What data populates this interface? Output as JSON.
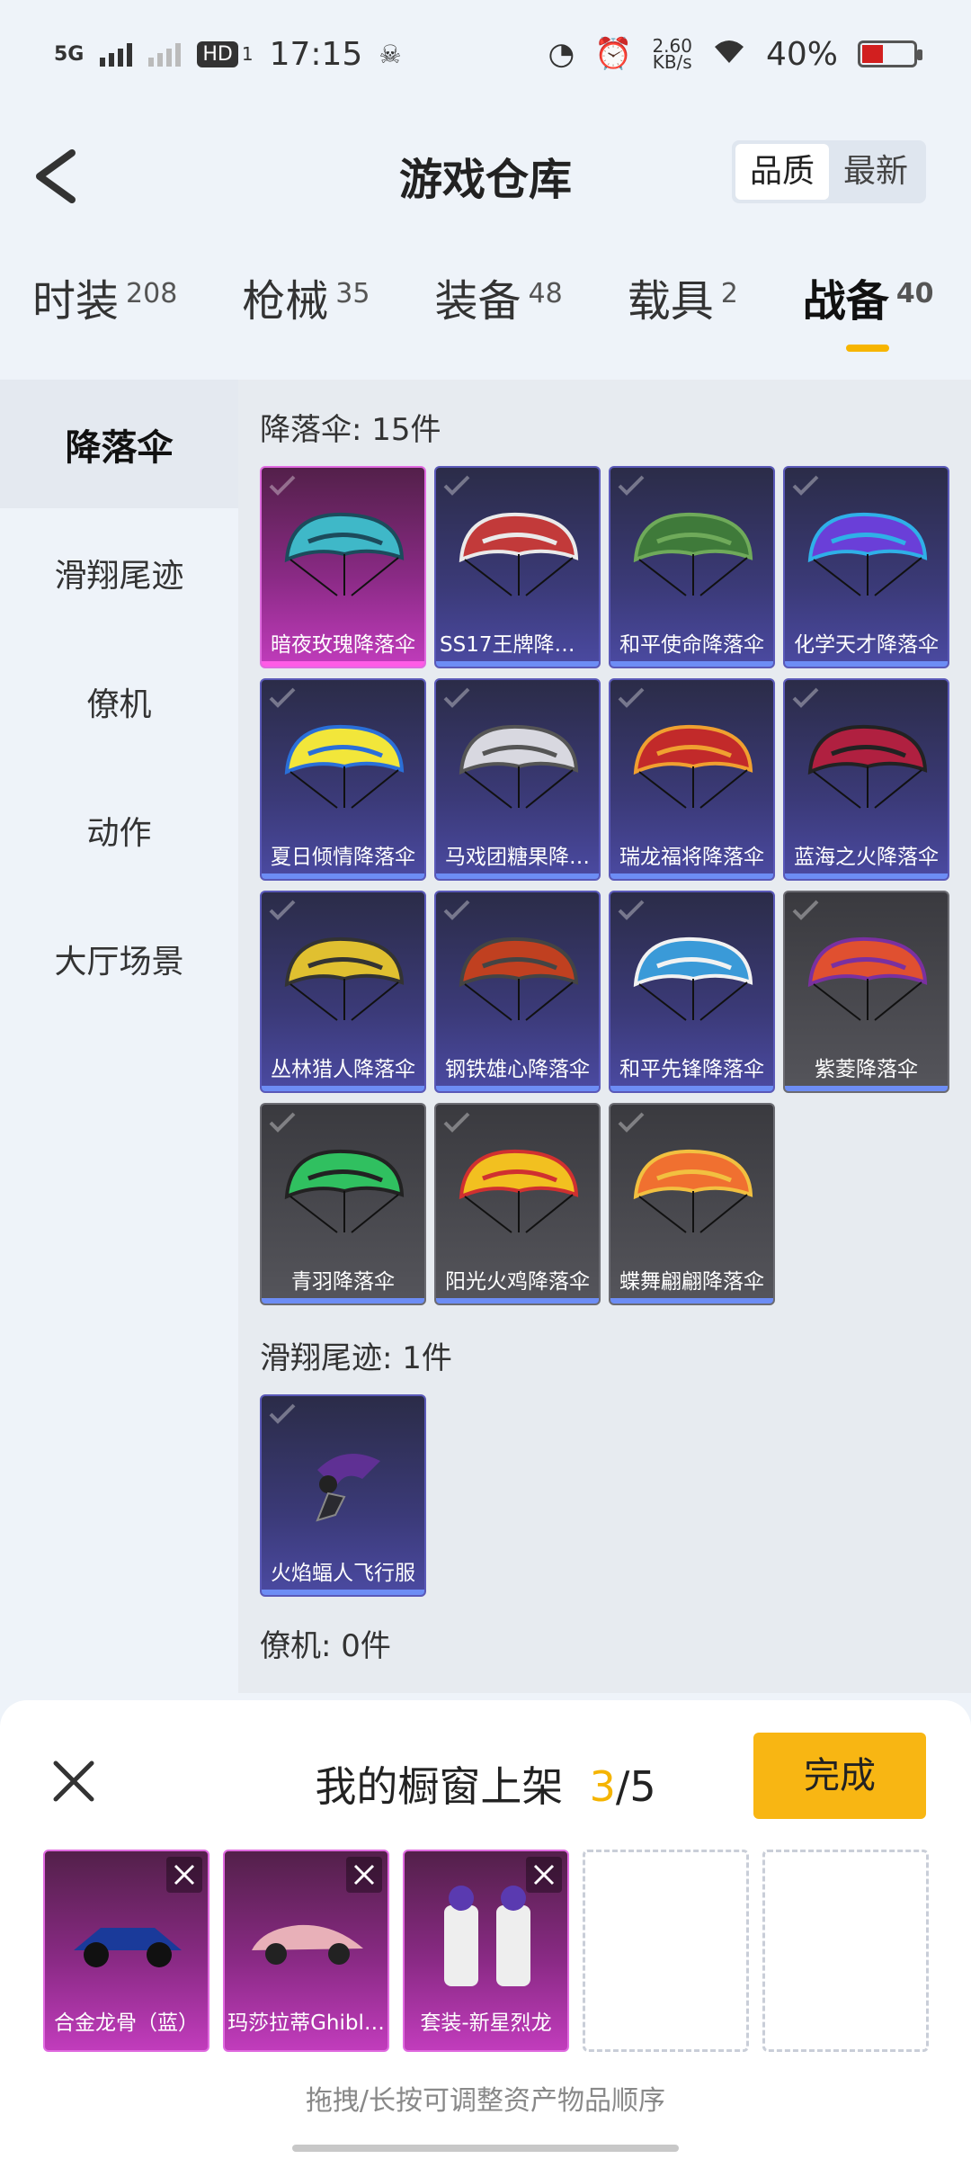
{
  "status": {
    "network": "5G",
    "hd": "HD",
    "hd_sub": "1",
    "time": "17:15",
    "speed_value": "2.60",
    "speed_unit": "KB/s",
    "battery": "40%"
  },
  "header": {
    "title": "游戏仓库",
    "sort": [
      "品质",
      "最新"
    ]
  },
  "tabs": [
    {
      "label": "时装",
      "count": "208"
    },
    {
      "label": "枪械",
      "count": "35"
    },
    {
      "label": "装备",
      "count": "48"
    },
    {
      "label": "载具",
      "count": "2"
    },
    {
      "label": "战备",
      "count": "40"
    }
  ],
  "sidebar": [
    "降落伞",
    "滑翔尾迹",
    "僚机",
    "动作",
    "大厅场景"
  ],
  "sections": {
    "parachute": "降落伞: 15件",
    "trail": "滑翔尾迹: 1件",
    "wingman": "僚机: 0件"
  },
  "parachutes": [
    "暗夜玫瑰降落伞",
    "SS17王牌降落伞",
    "和平使命降落伞",
    "化学天才降落伞",
    "夏日倾情降落伞",
    "马戏团糖果降…",
    "瑞龙福将降落伞",
    "蓝海之火降落伞",
    "丛林猎人降落伞",
    "钢铁雄心降落伞",
    "和平先锋降落伞",
    "紫菱降落伞",
    "青羽降落伞",
    "阳光火鸡降落伞",
    "蝶舞翩翩降落伞"
  ],
  "trails": [
    "火焰蝠人飞行服"
  ],
  "panel": {
    "title": "我的橱窗上架",
    "count": "3",
    "total": "/5",
    "done": "完成",
    "items": [
      "合金龙骨（蓝）",
      "玛莎拉蒂Ghibl…",
      "套装-新星烈龙"
    ],
    "hint": "拖拽/长按可调整资产物品顺序"
  }
}
